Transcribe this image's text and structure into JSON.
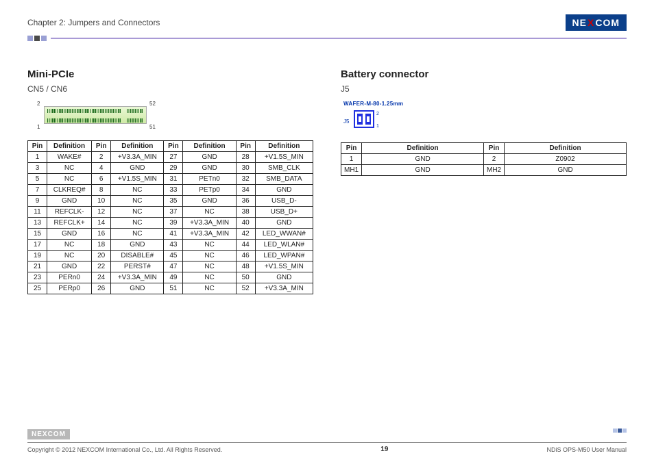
{
  "header": {
    "chapter": "Chapter 2: Jumpers and Connectors",
    "logo_text_left": "NE",
    "logo_text_x": "X",
    "logo_text_right": "COM"
  },
  "left": {
    "title": "Mini-PCIe",
    "sub": "CN5 / CN6",
    "diag_top_left": "2",
    "diag_top_right": "52",
    "diag_bot_left": "1",
    "diag_bot_right": "51",
    "headers": [
      "Pin",
      "Definition",
      "Pin",
      "Definition",
      "Pin",
      "Definition",
      "Pin",
      "Definition"
    ],
    "rows": [
      [
        "1",
        "WAKE#",
        "2",
        "+V3.3A_MIN",
        "27",
        "GND",
        "28",
        "+V1.5S_MIN"
      ],
      [
        "3",
        "NC",
        "4",
        "GND",
        "29",
        "GND",
        "30",
        "SMB_CLK"
      ],
      [
        "5",
        "NC",
        "6",
        "+V1.5S_MIN",
        "31",
        "PETn0",
        "32",
        "SMB_DATA"
      ],
      [
        "7",
        "CLKREQ#",
        "8",
        "NC",
        "33",
        "PETp0",
        "34",
        "GND"
      ],
      [
        "9",
        "GND",
        "10",
        "NC",
        "35",
        "GND",
        "36",
        "USB_D-"
      ],
      [
        "11",
        "REFCLK-",
        "12",
        "NC",
        "37",
        "NC",
        "38",
        "USB_D+"
      ],
      [
        "13",
        "REFCLK+",
        "14",
        "NC",
        "39",
        "+V3.3A_MIN",
        "40",
        "GND"
      ],
      [
        "15",
        "GND",
        "16",
        "NC",
        "41",
        "+V3.3A_MIN",
        "42",
        "LED_WWAN#"
      ],
      [
        "17",
        "NC",
        "18",
        "GND",
        "43",
        "NC",
        "44",
        "LED_WLAN#"
      ],
      [
        "19",
        "NC",
        "20",
        "DISABLE#",
        "45",
        "NC",
        "46",
        "LED_WPAN#"
      ],
      [
        "21",
        "GND",
        "22",
        "PERST#",
        "47",
        "NC",
        "48",
        "+V1.5S_MIN"
      ],
      [
        "23",
        "PERn0",
        "24",
        "+V3.3A_MIN",
        "49",
        "NC",
        "50",
        "GND"
      ],
      [
        "25",
        "PERp0",
        "26",
        "GND",
        "51",
        "NC",
        "52",
        "+V3.3A_MIN"
      ]
    ]
  },
  "right": {
    "title": "Battery connector",
    "sub": "J5",
    "diag_text": "WAFER-M-80-1.25mm",
    "diag_ref": "J5",
    "diag_p2": "2",
    "diag_p1": "1",
    "headers": [
      "Pin",
      "Definition",
      "Pin",
      "Definition"
    ],
    "rows": [
      [
        "1",
        "GND",
        "2",
        "Z0902"
      ],
      [
        "MH1",
        "GND",
        "MH2",
        "GND"
      ]
    ]
  },
  "footer": {
    "copyright": "Copyright © 2012 NEXCOM International Co., Ltd. All Rights Reserved.",
    "page": "19",
    "manual": "NDiS OPS-M50 User Manual"
  }
}
